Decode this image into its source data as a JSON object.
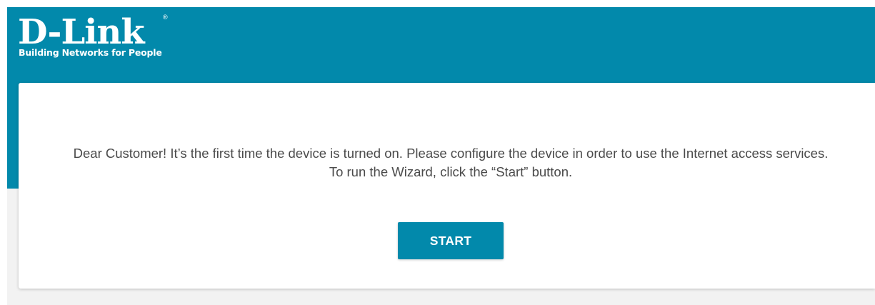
{
  "header": {
    "logo": {
      "wordmark": "D-Link",
      "registered_mark": "®",
      "tagline": "Building Networks for People"
    }
  },
  "main": {
    "message_line1": "Dear Customer! It’s the first time the device is turned on. Please configure the device in order to use the Internet access services.",
    "message_line2": "To run the Wizard, click the “Start” button.",
    "start_button_label": "START"
  },
  "colors": {
    "brand_teal": "#0289ab",
    "page_background": "#f2f2f2",
    "card_background": "#ffffff",
    "body_text": "#4a4a4a"
  }
}
